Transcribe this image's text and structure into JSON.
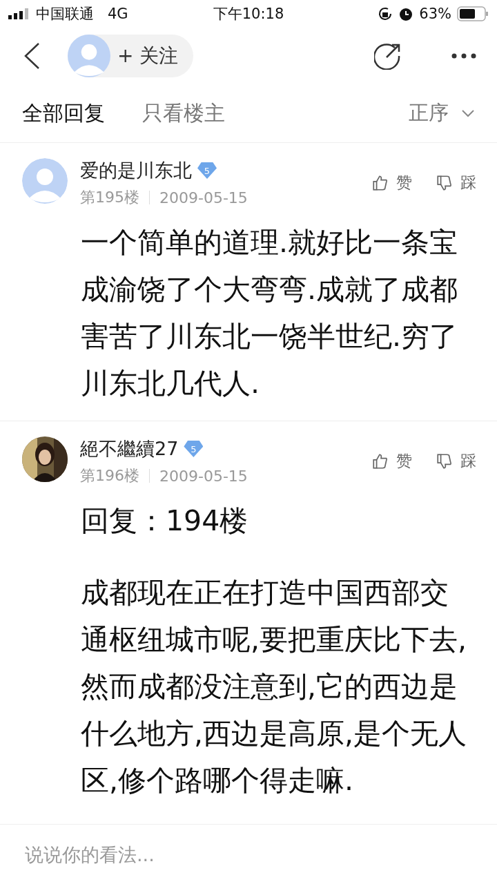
{
  "status_bar": {
    "carrier": "中国联通",
    "network": "4G",
    "time": "下午10:18",
    "battery": "63%"
  },
  "nav": {
    "follow_label": "+ 关注"
  },
  "tabs": [
    {
      "label": "全部回复",
      "selected": true
    },
    {
      "label": "只看楼主",
      "selected": false
    }
  ],
  "sort": {
    "label": "正序"
  },
  "posts": [
    {
      "author": "爱的是川东北",
      "level": "5",
      "floor": "第195楼",
      "date": "2009-05-15",
      "like": "赞",
      "dislike": "踩",
      "avatar": {
        "kind": "placeholder"
      },
      "paragraphs": [
        "一个简单的道理.就好比一条宝成渝饶了个大弯弯.成就了成都害苦了川东北一饶半世纪.穷了川东北几代人."
      ]
    },
    {
      "author": "絕不繼續27",
      "level": "5",
      "floor": "第196楼",
      "date": "2009-05-15",
      "like": "赞",
      "dislike": "踩",
      "paragraphs": [
        "回复：194楼",
        "成都现在正在打造中国西部交通枢纽城市呢,要把重庆比下去,然而成都没注意到,它的西边是什么地方,西边是高原,是个无人区,修个路哪个得走嘛."
      ]
    }
  ],
  "comment_bar": {
    "placeholder": "说说你的看法..."
  }
}
